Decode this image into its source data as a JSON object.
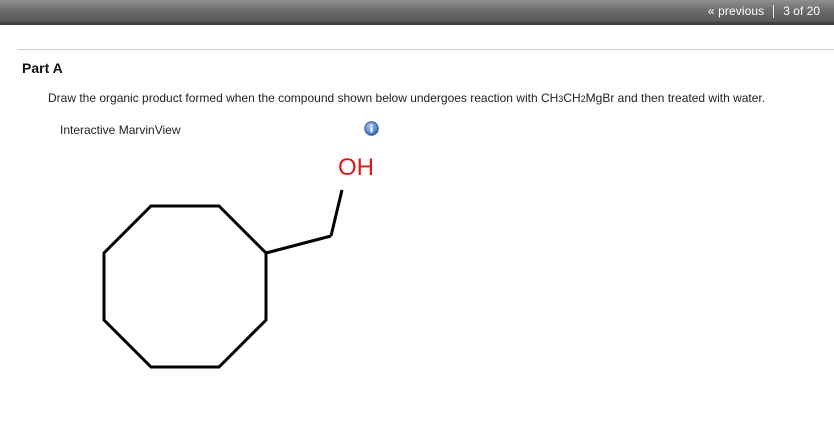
{
  "nav": {
    "previous_label": "« previous",
    "page_count": "3 of 20"
  },
  "part": {
    "title": "Part A",
    "question_prefix": "Draw the organic product formed when the compound shown below undergoes reaction with CH",
    "sub1": "3",
    "mid1": "CH",
    "sub2": "2",
    "question_suffix": "MgBr and then treated with water."
  },
  "viewer": {
    "label": "Interactive MarvinView",
    "info_icon": "info-icon"
  },
  "molecule": {
    "hydroxyl_label": "OH",
    "bond_color": "#000000",
    "hydroxyl_color": "#e8141b"
  },
  "colors": {
    "topbar": "#6e6e6e",
    "info_blue": "#3f6fb5"
  }
}
